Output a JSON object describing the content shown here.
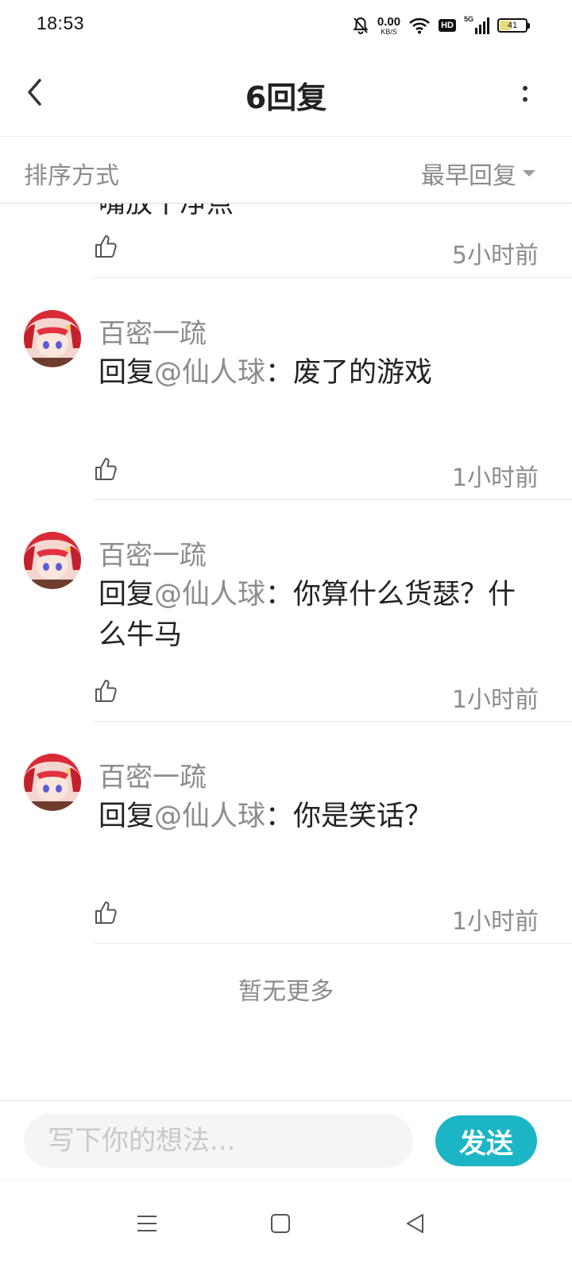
{
  "status_bar": {
    "time": "18:53",
    "net_speed_value": "0.00",
    "net_speed_unit": "KB/S",
    "hd_label": "HD",
    "signal_label": "5G",
    "battery_level": "41"
  },
  "header": {
    "title": "6回复"
  },
  "sort": {
    "label": "排序方式",
    "value": "最早回复"
  },
  "partial_comment": {
    "text": "嘴放干净点",
    "time": "5小时前"
  },
  "comments": [
    {
      "username": "百密一疏",
      "reply_prefix": "回复",
      "mention": "@仙人球",
      "text": "：废了的游戏",
      "time": "1小时前"
    },
    {
      "username": "百密一疏",
      "reply_prefix": "回复",
      "mention": "@仙人球",
      "text": "：你算什么货瑟？什么牛马",
      "time": "1小时前"
    },
    {
      "username": "百密一疏",
      "reply_prefix": "回复",
      "mention": "@仙人球",
      "text": "：你是笑话？",
      "time": "1小时前"
    }
  ],
  "footer": {
    "no_more": "暂无更多"
  },
  "input": {
    "placeholder": "写下你的想法...",
    "send_label": "发送"
  },
  "colors": {
    "accent": "#1bb5c5",
    "muted_text": "#8c8c8c"
  }
}
